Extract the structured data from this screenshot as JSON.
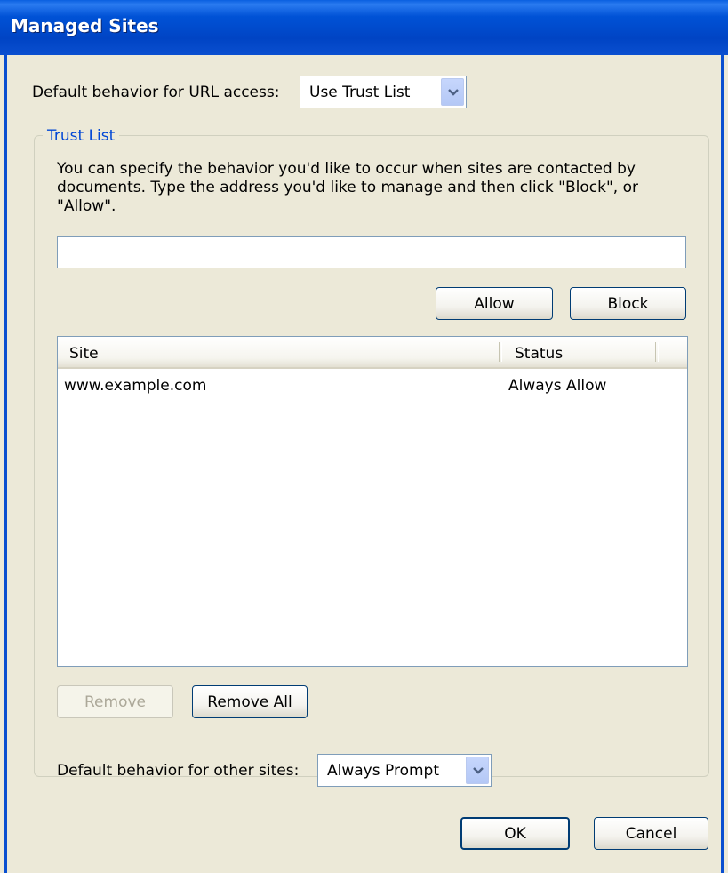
{
  "window": {
    "title": "Managed Sites"
  },
  "url_access": {
    "label": "Default behavior for URL access:",
    "selected": "Use Trust List"
  },
  "trust_list": {
    "legend": "Trust List",
    "description": "You can specify the behavior you'd like to occur when sites are contacted by\ndocuments. Type the address you'd like to manage and then click \"Block\", or\n\"Allow\".",
    "address_value": "",
    "allow_label": "Allow",
    "block_label": "Block",
    "columns": [
      "Site",
      "Status"
    ],
    "rows": [
      {
        "site": "www.example.com",
        "status": "Always Allow"
      }
    ],
    "remove_label": "Remove",
    "remove_all_label": "Remove All"
  },
  "other_sites": {
    "label": "Default behavior for other sites:",
    "selected": "Always Prompt"
  },
  "footer": {
    "ok_label": "OK",
    "cancel_label": "Cancel"
  },
  "colors": {
    "titlebar": "#0052d6",
    "dialog_bg": "#ece9d8",
    "legend_text": "#0046d5",
    "button_border": "#003c74"
  },
  "icons": {
    "dropdown": "chevron-down-icon"
  }
}
